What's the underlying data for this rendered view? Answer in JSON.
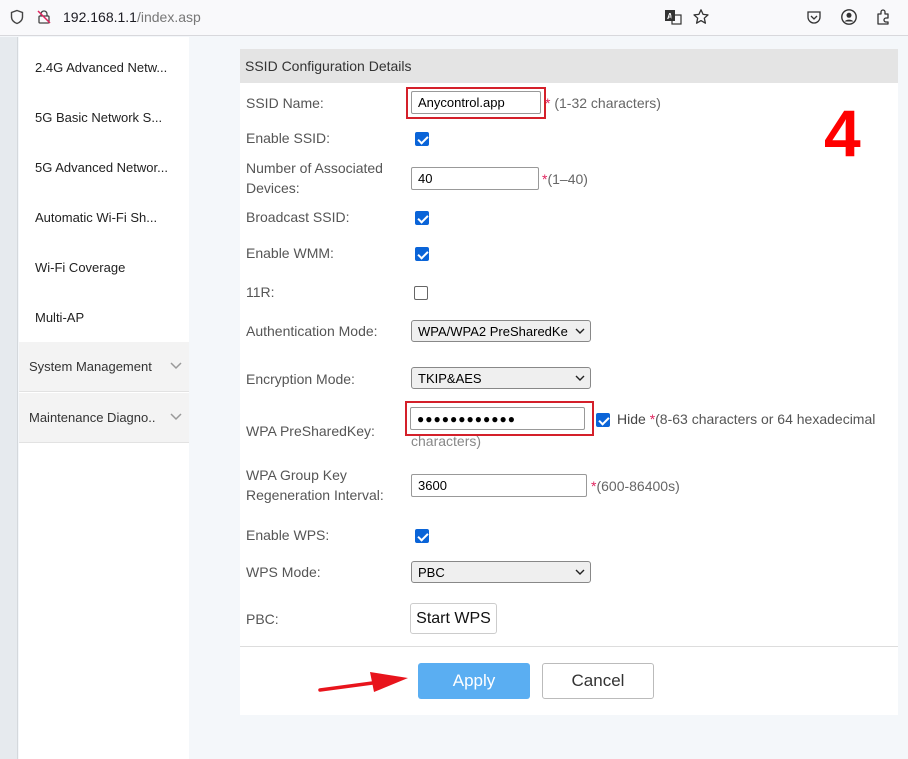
{
  "browser": {
    "url_host": "192.168.1.1",
    "url_path": "/index.asp",
    "icons": [
      "shield-icon",
      "insecure-lock-icon",
      "translate-icon",
      "bookmark-star-icon",
      "pocket-icon",
      "account-icon",
      "extensions-icon"
    ]
  },
  "sidebar": {
    "items": [
      {
        "label": "2.4G Advanced Netw..."
      },
      {
        "label": "5G Basic Network S..."
      },
      {
        "label": "5G Advanced Networ..."
      },
      {
        "label": "Automatic Wi-Fi Sh..."
      },
      {
        "label": "Wi-Fi Coverage"
      },
      {
        "label": "Multi-AP"
      }
    ],
    "groups": [
      {
        "label": "System Management"
      },
      {
        "label": "Maintenance Diagno.."
      }
    ]
  },
  "form": {
    "title": "SSID Configuration Details",
    "ssid_name": {
      "label": "SSID Name:",
      "value": "Anycontrol.app",
      "hint_star": "*",
      "hint": " (1-32 characters)"
    },
    "enable_ssid": {
      "label": "Enable SSID:",
      "checked": true
    },
    "assoc_devices": {
      "label_line1": "Number of Associated",
      "label_line2": "Devices:",
      "value": "40",
      "hint_star": "*",
      "hint": "(1–40)"
    },
    "broadcast_ssid": {
      "label": "Broadcast SSID:",
      "checked": true
    },
    "enable_wmm": {
      "label": "Enable WMM:",
      "checked": true
    },
    "r11": {
      "label": "11R:",
      "checked": false
    },
    "auth_mode": {
      "label": "Authentication Mode:",
      "value": "WPA/WPA2 PreSharedKe"
    },
    "encryption_mode": {
      "label": "Encryption Mode:",
      "value": "TKIP&AES"
    },
    "psk": {
      "label": "WPA PreSharedKey:",
      "value": "●●●●●●●●●●●●",
      "hide_label": "Hide",
      "hide_checked": true,
      "hint_star": "*",
      "hint_line1": "(8-63 characters or 64 hexadecimal",
      "hint_line2": "characters)"
    },
    "group_key": {
      "label_line1": "WPA Group Key",
      "label_line2": "Regeneration Interval:",
      "value": "3600",
      "hint_star": "*",
      "hint": "(600-86400s)"
    },
    "enable_wps": {
      "label": "Enable WPS:",
      "checked": true
    },
    "wps_mode": {
      "label": "WPS Mode:",
      "value": "PBC"
    },
    "pbc": {
      "label": "PBC:",
      "button": "Start WPS"
    },
    "apply": "Apply",
    "cancel": "Cancel"
  },
  "annotation": {
    "step_number": "4",
    "color": "#ff0000"
  }
}
